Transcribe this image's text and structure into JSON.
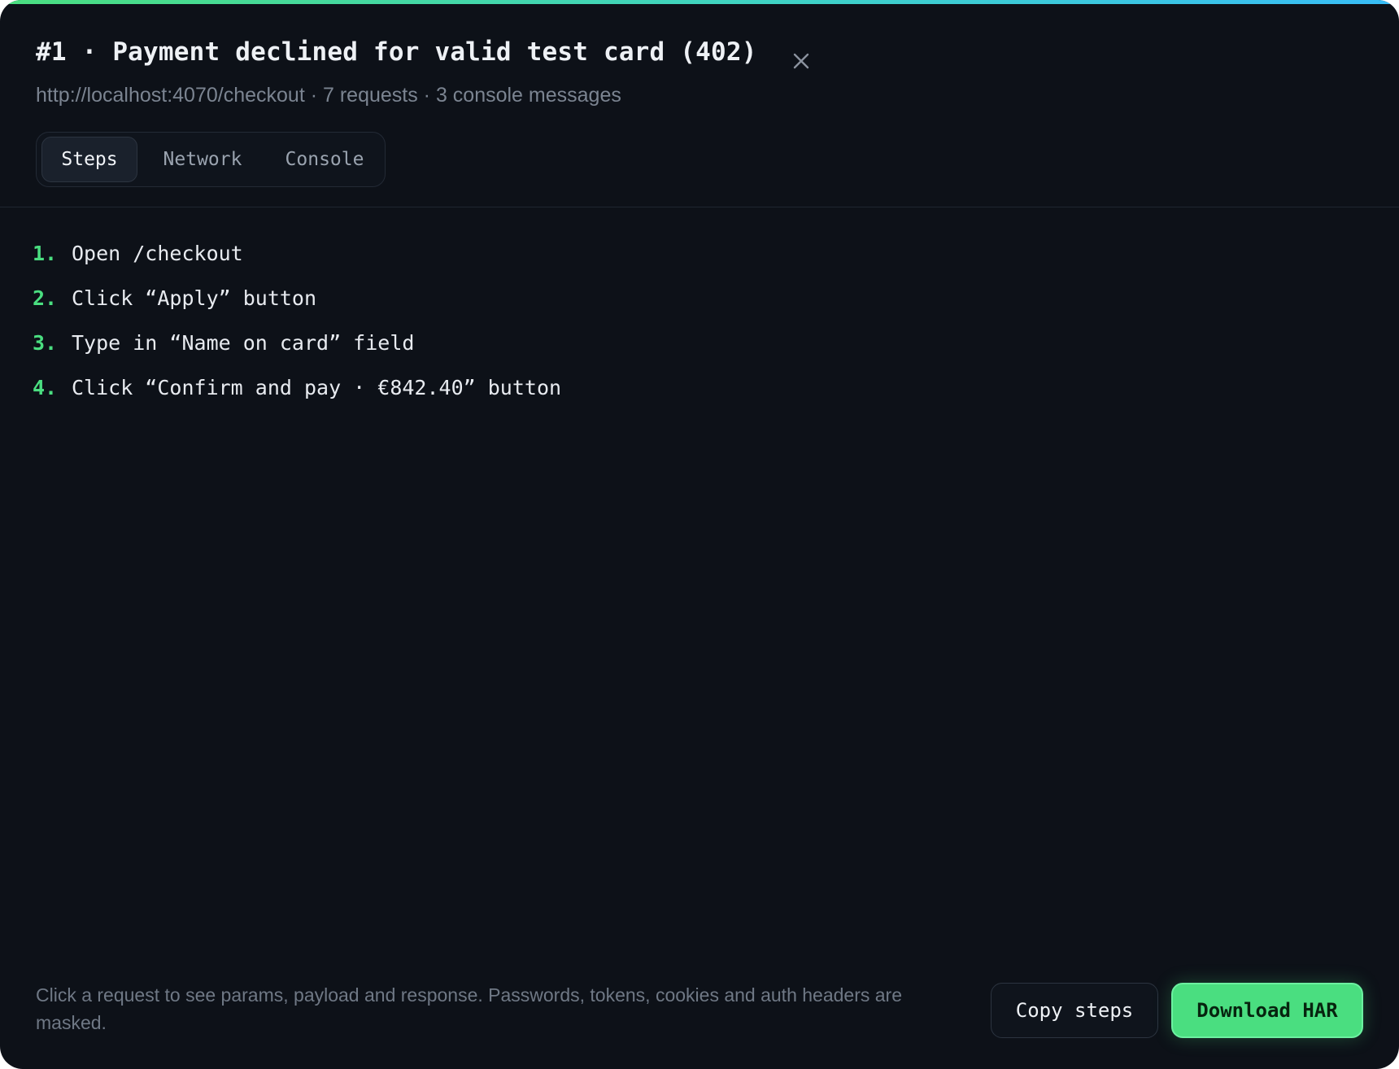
{
  "colors": {
    "background": "#0d1118",
    "accent": "#4ade80",
    "accent_gradient_end": "#38bdf8",
    "muted_text": "#7b8491"
  },
  "modal": {
    "title": "#1 · Payment declined for valid test card (402)",
    "subtitle": "http://localhost:4070/checkout · 7 requests · 3 console messages",
    "close_icon": "close-icon"
  },
  "tabs": [
    {
      "label": "Steps",
      "active": true
    },
    {
      "label": "Network",
      "active": false
    },
    {
      "label": "Console",
      "active": false
    }
  ],
  "steps": [
    {
      "number": "1.",
      "text": "Open /checkout"
    },
    {
      "number": "2.",
      "text": "Click “Apply” button"
    },
    {
      "number": "3.",
      "text": "Type in “Name on card” field"
    },
    {
      "number": "4.",
      "text": "Click “Confirm and pay · €842.40” button"
    }
  ],
  "footer": {
    "note": "Click a request to see params, payload and response. Passwords, tokens, cookies and auth headers are masked.",
    "copy_label": "Copy steps",
    "download_label": "Download HAR"
  }
}
